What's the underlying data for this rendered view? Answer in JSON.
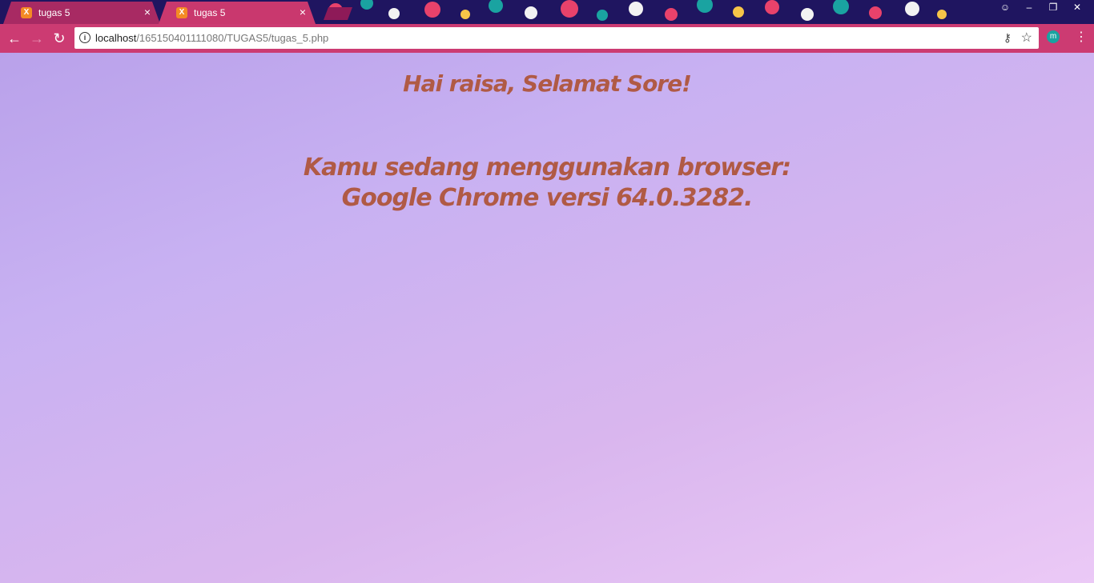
{
  "tabs": [
    {
      "title": "tugas 5",
      "favicon": "xampp-icon",
      "close": "×"
    },
    {
      "title": "tugas 5",
      "favicon": "xampp-icon",
      "close": "×"
    }
  ],
  "window_controls": {
    "minimize": "–",
    "restore": "❐",
    "close": "✕"
  },
  "toolbar": {
    "back": "←",
    "forward": "→",
    "reload": "↻",
    "url_host": "localhost",
    "url_path": "/165150401111080/TUGAS5/tugas_5.php",
    "profile_initial": "m",
    "menu": "⋮"
  },
  "page": {
    "greeting": "Hai raisa, Selamat Sore!",
    "browser_line_1": "Kamu sedang menggunakan browser:",
    "browser_line_2": "Google Chrome versi 64.0.3282."
  },
  "colors": {
    "theme_pink": "#cc3b72",
    "text_color": "#b05a45"
  }
}
